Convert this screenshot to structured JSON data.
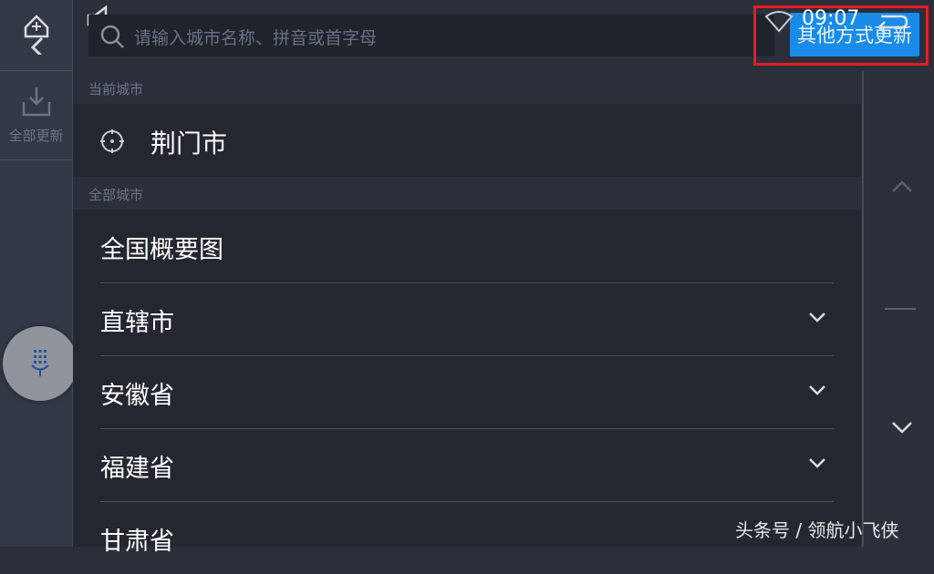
{
  "header": {
    "search_placeholder": "请输入城市名称、拼音或首字母",
    "other_update_label": "其他方式更新",
    "time": "09:07"
  },
  "left_rail": {
    "update_all_label": "全部更新"
  },
  "current_section": {
    "header": "当前城市",
    "city": "荆门市"
  },
  "all_section": {
    "header": "全部城市",
    "items": [
      {
        "label": "全国概要图",
        "expandable": false
      },
      {
        "label": "直辖市",
        "expandable": true
      },
      {
        "label": "安徽省",
        "expandable": true
      },
      {
        "label": "福建省",
        "expandable": true
      },
      {
        "label": "甘肃省",
        "expandable": true
      }
    ]
  },
  "watermark": "头条号 / 领航小飞侠",
  "colors": {
    "background": "#2b2f3a",
    "row_background": "#232730",
    "accent_button": "#1a8ce8",
    "highlight": "#e81c24"
  },
  "icons": [
    "back-icon",
    "speaker-icon",
    "search-icon",
    "wifi-icon",
    "return-icon",
    "download-icon",
    "microphone-icon",
    "locate-icon",
    "chevron-down-icon",
    "chevron-up-icon"
  ]
}
